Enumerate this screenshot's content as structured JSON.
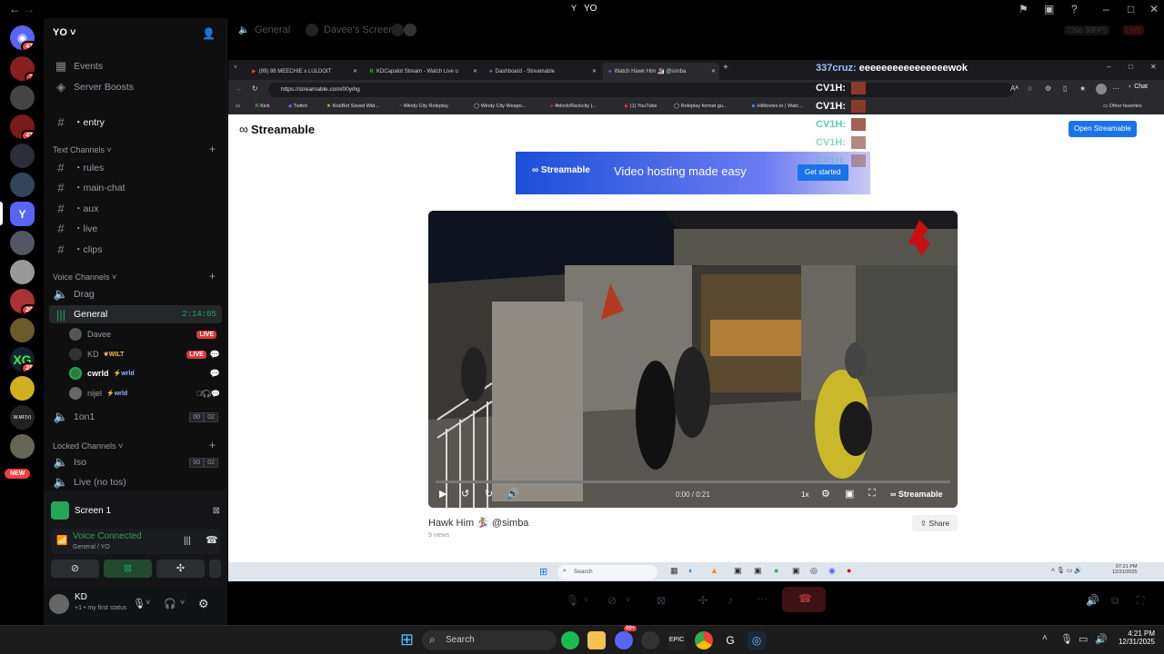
{
  "titlebar": {
    "title": "YO"
  },
  "server": {
    "name": "YO"
  },
  "rail": {
    "badges": [
      "43",
      "2",
      "47",
      "20",
      "28"
    ],
    "new_label": "NEW"
  },
  "sidebar": {
    "events": "Events",
    "boosts": "Server Boosts",
    "entry": "・entry",
    "text_category": "Text Channels",
    "text_channels": [
      "・rules",
      "・main-chat",
      "・aux",
      "・live",
      "・clips"
    ],
    "voice_category": "Voice Channels",
    "drag": "Drag",
    "general": "General",
    "general_timer": "2:14:05",
    "users": [
      {
        "name": "Davee",
        "tag": "",
        "live": "LIVE"
      },
      {
        "name": "KD",
        "tag": "WILT",
        "live": "LIVE"
      },
      {
        "name": "cwrld",
        "tag": "wrld",
        "live": ""
      },
      {
        "name": "nijel",
        "tag": "wrld",
        "live": ""
      }
    ],
    "oneonone": "1on1",
    "oneonone_count": [
      "00",
      "02"
    ],
    "locked_category": "Locked Channels",
    "iso": "Iso",
    "iso_count": [
      "00",
      "02"
    ],
    "live_no_tos": "Live (no tos)"
  },
  "voice_panel": {
    "screen_label": "Screen 1",
    "status": "Voice Connected",
    "location": "General / YO",
    "user": "KD",
    "user_status": "+1 • my first status"
  },
  "stream_header": {
    "channel": "General",
    "screen": "Davee's Screen",
    "quality": "720p 30FPS",
    "live": "LIVE"
  },
  "browser": {
    "tabs": [
      "(99) 98 MEECHIE x LULDOIT",
      "KDCapalot Stream - Watch Live o",
      "Dashboard - Streamable",
      "Watch Hawk Him 🏂 @simba"
    ],
    "url": "https://streamable.com/00yihg",
    "favorites": [
      "Kick",
      "Twitch",
      "KickBot Saved Wid...",
      "Windy City Roleplay",
      "Windy City Weapo...",
      "4block/Rackcity |...",
      "(1) YouTube",
      "Roleplay format gu...",
      "HiMovies.to | Watc..."
    ],
    "other_favorites": "Other favorites",
    "chat_label": "Chat"
  },
  "chat_overlay": {
    "user1": "337cruz:",
    "msg1": "eeeeeeeeeeeeeeeewok",
    "user2": "CV1H:",
    "user3": "CV1H:"
  },
  "streamable": {
    "logo": "Streamable",
    "open_button": "Open Streamable",
    "ad_logo": "Streamable",
    "ad_text": "Video hosting made easy",
    "ad_button": "Get started",
    "time": "0:00 / 0:21",
    "speed": "1x",
    "brand": "Streamable",
    "video_title": "Hawk Him 🏂 @simba",
    "views": "9 views",
    "share": "Share",
    "progress": 0.0
  },
  "inner_taskbar": {
    "search": "Search",
    "time": "07:21 PM",
    "date": "12/31/2025"
  },
  "taskbar": {
    "search": "Search",
    "time": "4:21 PM",
    "date": "12/31/2025",
    "badge": "99+"
  }
}
